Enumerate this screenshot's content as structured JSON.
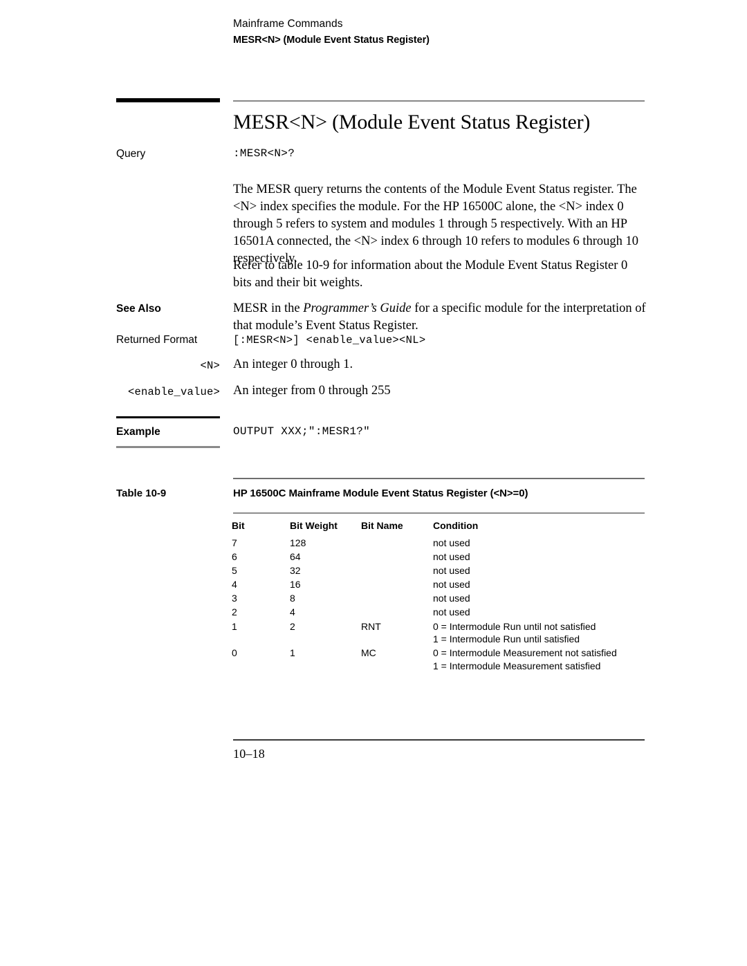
{
  "running_head": {
    "chapter": "Mainframe Commands",
    "section": "MESR<N> (Module Event Status Register)"
  },
  "title": "MESR<N> (Module Event Status Register)",
  "sections": {
    "query": {
      "label": "Query",
      "syntax": ":MESR<N>?"
    },
    "description": {
      "paragraph_1": "The MESR query returns the contents of the Module Event Status register. The <N> index specifies the module.  For the HP 16500C alone, the <N> index 0 through 5 refers to system and modules 1 through 5 respectively. With an HP 16501A connected, the <N> index 6 through 10 refers to modules 6 through 10 respectively.",
      "paragraph_2": "Refer to table 10-9 for information about the Module Event Status Register 0 bits and their bit weights."
    },
    "see_also": {
      "label": "See Also",
      "text_before": "MESR in the ",
      "text_italic": "Programmer’s Guide",
      "text_after": " for a specific module for the interpretation of that module’s Event Status Register."
    },
    "returned_format": {
      "label": "Returned Format",
      "syntax": "[:MESR<N>] <enable_value><NL>"
    },
    "parameters": [
      {
        "name": "<N>",
        "description": "An integer 0 through 1."
      },
      {
        "name": "<enable_value>",
        "description": "An integer from 0 through 255"
      }
    ],
    "example": {
      "label": "Example",
      "code": "OUTPUT XXX;\":MESR1?\""
    }
  },
  "table": {
    "number_label": "Table 10-9",
    "caption": "HP 16500C Mainframe Module Event Status Register  (<N>=0)",
    "headers": [
      "Bit",
      "Bit Weight",
      "Bit Name",
      "Condition"
    ],
    "rows": [
      {
        "bit": "7",
        "weight": "128",
        "name": "",
        "conditions": [
          "not used"
        ]
      },
      {
        "bit": "6",
        "weight": "64",
        "name": "",
        "conditions": [
          "not used"
        ]
      },
      {
        "bit": "5",
        "weight": "32",
        "name": "",
        "conditions": [
          "not used"
        ]
      },
      {
        "bit": "4",
        "weight": "16",
        "name": "",
        "conditions": [
          "not used"
        ]
      },
      {
        "bit": "3",
        "weight": "8",
        "name": "",
        "conditions": [
          "not used"
        ]
      },
      {
        "bit": "2",
        "weight": "4",
        "name": "",
        "conditions": [
          "not used"
        ]
      },
      {
        "bit": "1",
        "weight": "2",
        "name": "RNT",
        "conditions": [
          "0 = Intermodule Run until not satisfied",
          "1 = Intermodule Run until satisfied"
        ]
      },
      {
        "bit": "0",
        "weight": "1",
        "name": "MC",
        "conditions": [
          "0 = Intermodule Measurement not satisfied",
          "1 = Intermodule Measurement satisfied"
        ]
      }
    ]
  },
  "footer": {
    "page_number": "10–18"
  }
}
